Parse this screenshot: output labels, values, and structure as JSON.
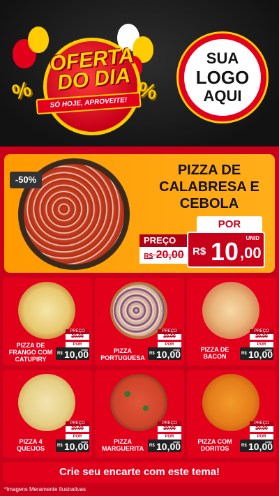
{
  "header": {
    "badge_line1": "OFERTA",
    "badge_line2": "DO DIA",
    "badge_ribbon": "SÓ HOJE, APROVEITE!",
    "percent_symbol": "%",
    "logo_lines": [
      "SUA",
      "LOGO",
      "AQUI"
    ]
  },
  "featured": {
    "discount": "-50%",
    "title": "PIZZA DE CALABRESA E CEBOLA",
    "preco_label": "PREÇO",
    "old_currency": "R$",
    "old_price": "20,00",
    "por_label": "POR",
    "unid_label": "UNID",
    "currency": "R$",
    "price_int": "10",
    "price_dec": ",00"
  },
  "cards": [
    {
      "name": "PIZZA DE FRANGO COM CATUPIRY",
      "preco_label": "PREÇO",
      "old_price": "20,00",
      "por_label": "POR",
      "currency": "R$",
      "price": "10,00",
      "unid_label": "UNID"
    },
    {
      "name": "PIZZA PORTUGUESA",
      "preco_label": "PREÇO",
      "old_price": "20,00",
      "por_label": "POR",
      "currency": "R$",
      "price": "10,00",
      "unid_label": "UNID"
    },
    {
      "name": "PIZZA DE BACON",
      "preco_label": "PREÇO",
      "old_price": "20,00",
      "por_label": "POR",
      "currency": "R$",
      "price": "10,00",
      "unid_label": "UNID"
    },
    {
      "name": "PIZZA 4 QUEIJOS",
      "preco_label": "PREÇO",
      "old_price": "20,00",
      "por_label": "POR",
      "currency": "R$",
      "price": "10,00",
      "unid_label": "UNID"
    },
    {
      "name": "PIZZA MARGUERITA",
      "preco_label": "PREÇO",
      "old_price": "20,00",
      "por_label": "POR",
      "currency": "R$",
      "price": "10,00",
      "unid_label": "UNID"
    },
    {
      "name": "PIZZA COM DORITOS",
      "preco_label": "PREÇO",
      "old_price": "20,00",
      "por_label": "POR",
      "currency": "R$",
      "price": "10,00",
      "unid_label": "UNID"
    }
  ],
  "cta": "Crie seu encarte com este tema!",
  "disclaimer": "*Imagens Meramente Ilustrativas",
  "colors": {
    "brand_red": "#e3001b",
    "dark_red": "#c8001a",
    "orange": "#ff9a00",
    "yellow": "#ffcc00"
  }
}
